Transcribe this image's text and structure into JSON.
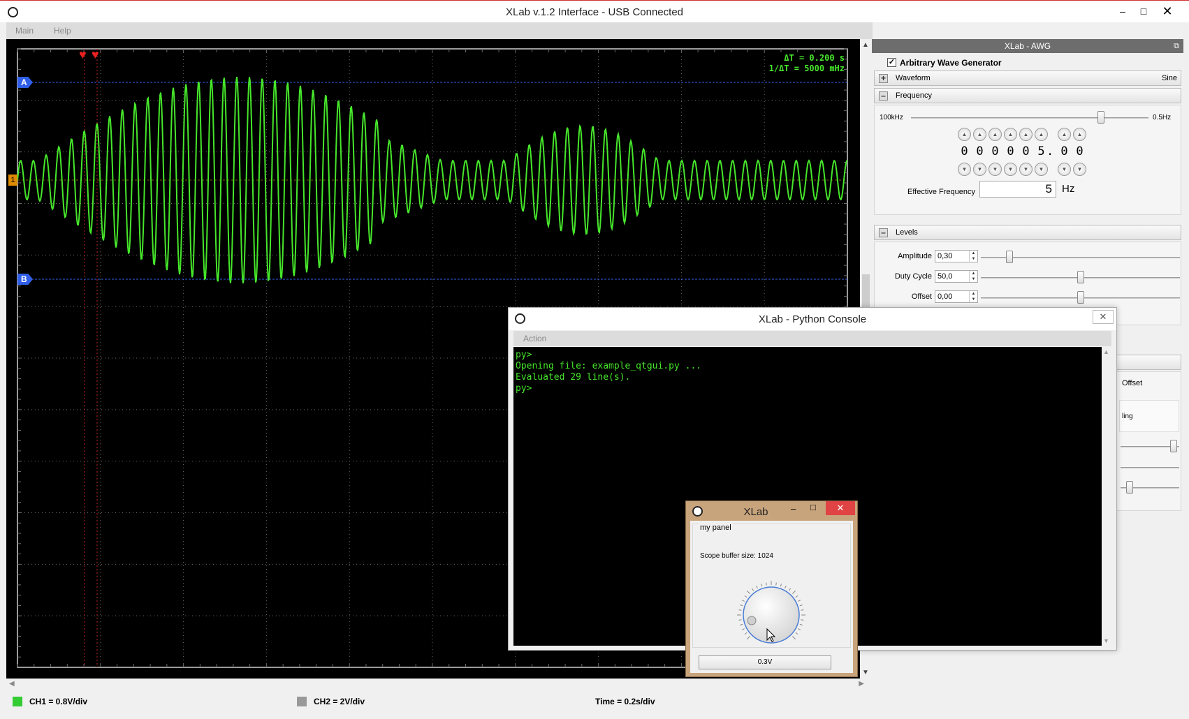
{
  "app": {
    "title": "XLab v.1.2   Interface - USB Connected",
    "menu": [
      "Main",
      "Help"
    ]
  },
  "scope": {
    "readout": {
      "dt_label": "ΔT =",
      "dt_value": "0.200 s",
      "inv_label": "1/ΔT =",
      "inv_value": "5000 mHz"
    },
    "cursor_a": "A",
    "cursor_b": "B",
    "ch1_marker": "1",
    "colors": {
      "trace": "#46e62b",
      "grid": "#6a6a6a",
      "cursor": "#2f5fe8",
      "trigger": "#e08a00"
    }
  },
  "status": {
    "ch1": "CH1 = 0.8V/div",
    "ch2": "CH2 = 2V/div",
    "time": "Time = 0.2s/div",
    "ch1_color": "#33cc33",
    "ch2_color": "#999999"
  },
  "awg": {
    "title": "XLab - AWG",
    "enable_label": "Arbitrary Wave Generator",
    "enabled": true,
    "waveform_label": "Waveform",
    "waveform_value": "Sine",
    "frequency_label": "Frequency",
    "freq_min": "100kHz",
    "freq_max": "0.5Hz",
    "freq_slider_fraction": 0.8,
    "digits": [
      "0",
      "0",
      "0",
      "0",
      "0",
      "5",
      ".",
      "0",
      "0"
    ],
    "effective_label": "Effective Frequency",
    "effective_value": "5",
    "effective_unit": "Hz",
    "levels_label": "Levels",
    "amplitude_label": "Amplitude",
    "amplitude_value": "0,30",
    "duty_label": "Duty Cycle",
    "duty_value": "50,0",
    "offset_label": "Offset",
    "offset_value": "0,00",
    "partial_offset": "Offset",
    "partial_ling": "ling"
  },
  "console": {
    "title": "XLab - Python Console",
    "menu": "Action",
    "lines": [
      "py>",
      "Opening file: example_qtgui.py ...",
      "Evaluated 29 line(s).",
      "py>"
    ]
  },
  "panel": {
    "title": "XLab",
    "group": "my panel",
    "buffer": "Scope buffer size: 1024",
    "button": "0.3V"
  }
}
